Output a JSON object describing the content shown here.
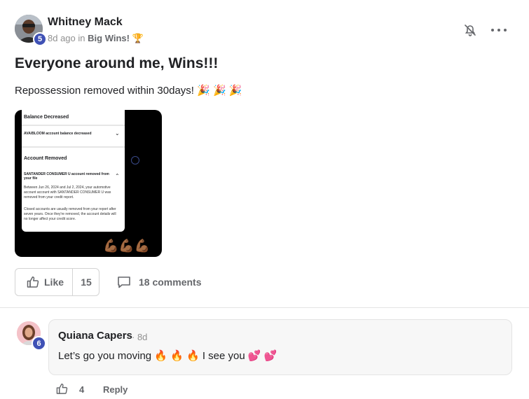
{
  "post": {
    "author": "Whitney Mack",
    "level": "5",
    "time": "8d ago",
    "in_word": "in",
    "category": "Big Wins!",
    "category_emoji": "🏆",
    "title": "Everyone around me, Wins!!!",
    "body": "Repossession removed within 30days!",
    "body_emojis": "🎉 🎉 🎉"
  },
  "attachment": {
    "section1_title": "Balance Decreased",
    "section1_row": "AVA/BLOOM account balance decreased",
    "section2_title": "Account Removed",
    "section2_row": "SANTANDER CONSUMER U account removed from your file",
    "section2_text1": "Between Jun 26, 2024 and Jul 2, 2024, your automotive account account with SANTANDER CONSUMER U was removed from your credit report.",
    "section2_text2": "Closed accounts are usually removed from your report after seven years. Once they're removed, the account details will no longer affect your credit score.",
    "chevron_down": "⌄",
    "chevron_up": "⌃",
    "flex_emojis": "💪🏾💪🏾💪🏾"
  },
  "actions": {
    "like_label": "Like",
    "like_count": "15",
    "comments_label": "18 comments"
  },
  "comment": {
    "author": "Quiana Capers",
    "level": "6",
    "time": "· 8d",
    "text": "Let’s go you moving 🔥 🔥 🔥  I see you 💕 💕",
    "like_count": "4",
    "reply_label": "Reply"
  },
  "colors": {
    "badge": "#3f51b5",
    "text": "#202124",
    "muted": "#65676b"
  }
}
